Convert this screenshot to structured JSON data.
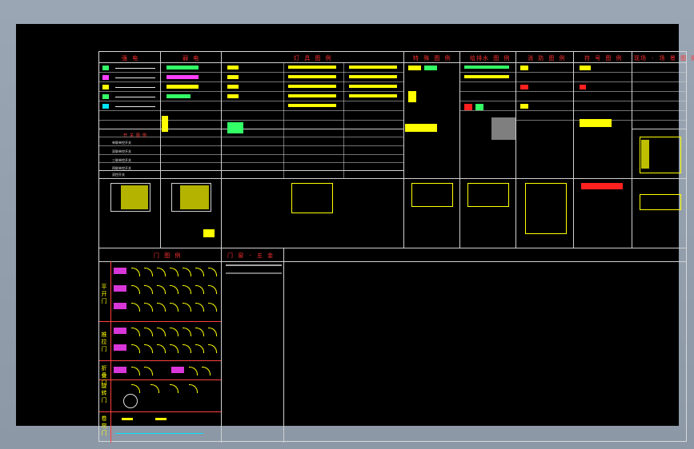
{
  "window": {
    "background": "#000000",
    "frame": "#d8d8d8"
  },
  "legend_sections": [
    {
      "id": "power",
      "title": "强 电"
    },
    {
      "id": "weak",
      "title": "弱 电"
    },
    {
      "id": "fixture",
      "title": "灯 具 图 例"
    },
    {
      "id": "special",
      "title": "特 殊 图 例"
    },
    {
      "id": "plumbing",
      "title": "给排水 图 例"
    },
    {
      "id": "fire",
      "title": "消 防 图 例"
    },
    {
      "id": "symbol",
      "title": "符 号 图 例"
    },
    {
      "id": "site",
      "title": "现场 · 场 景 图 例"
    }
  ],
  "door_section": {
    "title": "门 图 例",
    "rows": [
      "平 开 门",
      "推 拉 门",
      "折 叠 门",
      "旋 转 门",
      "卷 帘 门"
    ]
  },
  "window_section": {
    "title": "门 窗 · 五 金"
  },
  "power_list": {
    "title": "开 关 图 例",
    "items": [
      "单联单控开关",
      "双联单控开关",
      "三联单控开关",
      "四联单控开关",
      "双控开关"
    ]
  },
  "colors": {
    "title": "#ff3030",
    "primary": "#ffff00",
    "secondary": "#33ff66",
    "accent": "#00e5ff",
    "highlight": "#ff40ff"
  }
}
